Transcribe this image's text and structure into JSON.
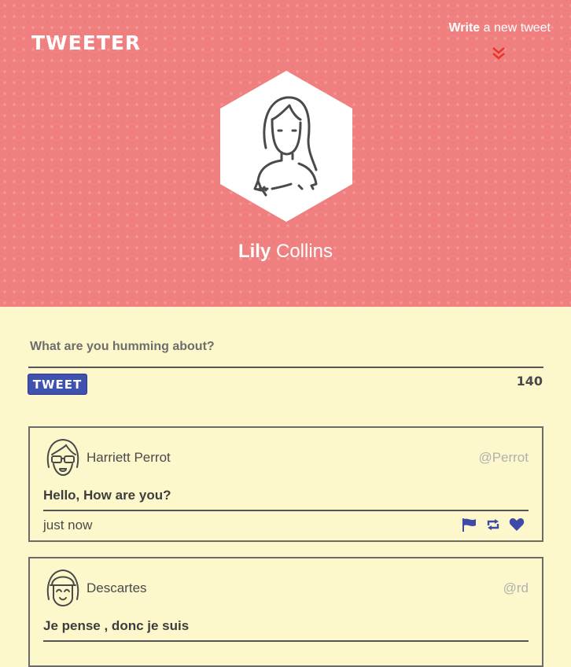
{
  "header": {
    "brand": "TWEETER",
    "write_strong": "Write",
    "write_rest": " a new tweet",
    "profile_first": "Lily",
    "profile_last": " Collins"
  },
  "compose": {
    "placeholder": "What are you humming about?",
    "button_label": "TWEET",
    "char_count": "140"
  },
  "tweets": [
    {
      "name": "Harriett Perrot",
      "handle": "@Perrot",
      "message": "Hello, How are you?",
      "time": "just now",
      "avatar_icon": "sunglasses-girl-avatar-icon"
    },
    {
      "name": "Descartes",
      "handle": "@rd",
      "message": "Je pense , donc je suis",
      "time": "",
      "avatar_icon": "smiling-girl-avatar-icon"
    }
  ],
  "colors": {
    "header_bg": "#f08080",
    "page_bg": "#fdf8cb",
    "accent": "#4052b0",
    "chevron": "#e8352a"
  },
  "icons": [
    "flag-icon",
    "retweet-icon",
    "heart-icon"
  ]
}
